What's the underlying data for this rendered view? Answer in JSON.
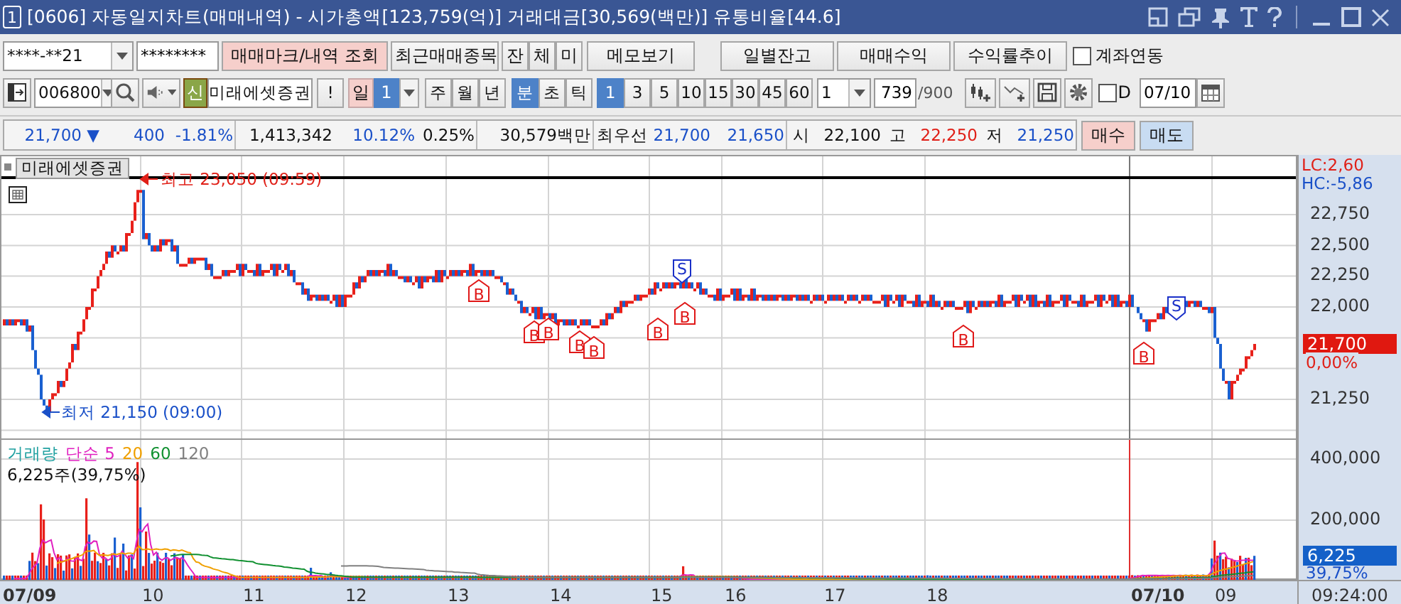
{
  "window": {
    "number": "1",
    "title": "[0606] 자동일지차트(매매내역) - 시가총액[123,759(억)] 거래대금[30,569(백만)] 유통비율[44.6]"
  },
  "toolbar_1": {
    "account": "****-**21",
    "password": "********",
    "buttons": [
      {
        "label": "매매마크/내역 조회",
        "kind": "primary"
      },
      {
        "label": "최근매매종목",
        "kind": "normal"
      },
      {
        "label": "잔",
        "kind": "small"
      },
      {
        "label": "체",
        "kind": "small"
      },
      {
        "label": "미",
        "kind": "small"
      },
      {
        "label": "메모보기",
        "kind": "wide"
      }
    ],
    "right_buttons": [
      "일별잔고",
      "매매수익",
      "수익률추이"
    ],
    "link_account": {
      "label": "계좌연동",
      "checked": false
    }
  },
  "toolbar_2": {
    "code": "006800",
    "credit_badge": "신",
    "stock_name": "미래에셋증권",
    "alert": "!",
    "day": {
      "label": "일",
      "value": "1"
    },
    "periods": [
      {
        "label": "주",
        "selected": false
      },
      {
        "label": "월",
        "selected": false
      },
      {
        "label": "년",
        "selected": false
      },
      {
        "label": "분",
        "selected": true
      },
      {
        "label": "초",
        "selected": false
      },
      {
        "label": "틱",
        "selected": false
      }
    ],
    "intervals": [
      {
        "label": "1",
        "selected": true
      },
      {
        "label": "3",
        "selected": false
      },
      {
        "label": "5",
        "selected": false
      },
      {
        "label": "10",
        "selected": false
      },
      {
        "label": "15",
        "selected": false
      },
      {
        "label": "30",
        "selected": false
      },
      {
        "label": "45",
        "selected": false
      },
      {
        "label": "60",
        "selected": false
      }
    ],
    "count_combo": "1",
    "count": "739",
    "max_count": "/900",
    "d_option": {
      "label": "D",
      "checked": false
    },
    "date": "07/10"
  },
  "quote_strip": {
    "items": [
      {
        "text": "21,700 ▼",
        "color": "#1a50c8"
      },
      {
        "text": "400",
        "color": "#1a50c8"
      },
      {
        "text": "-1.81%",
        "color": "#1a50c8"
      },
      {
        "text": "1,413,342",
        "color": "#111111"
      },
      {
        "text": "10.12%",
        "color": "#1a50c8"
      },
      {
        "text": "0.25%",
        "color": "#111111"
      },
      {
        "text": "30,579백만",
        "color": "#111111"
      },
      {
        "text": "최우선",
        "color": "#111111"
      },
      {
        "text": "21,700",
        "color": "#1a50c8"
      },
      {
        "text": "21,650",
        "color": "#1a50c8"
      },
      {
        "text": "시",
        "color": "#111111"
      },
      {
        "text": "22,100",
        "color": "#111111"
      },
      {
        "text": "고",
        "color": "#111111"
      },
      {
        "text": "22,250",
        "color": "#e02018"
      },
      {
        "text": "저",
        "color": "#111111"
      },
      {
        "text": "21,250",
        "color": "#1a50c8"
      }
    ],
    "buy": "매수",
    "sell": "매도"
  },
  "chart": {
    "stock_label": "미래에셋증권",
    "high_annotation": "최고 23,050 (09:59)",
    "low_annotation": "최저 21,150 (09:00)",
    "lc": "LC:2,60",
    "hc": "HC:-5,86",
    "price_ticks": [
      "22,750",
      "22,500",
      "22,250",
      "22,000",
      "21,250"
    ],
    "current_price": "21,700",
    "current_change": "0,00%",
    "markers": [
      {
        "label": "B",
        "kind": "buy"
      },
      {
        "label": "B",
        "kind": "buy"
      },
      {
        "label": "B",
        "kind": "buy"
      },
      {
        "label": "B",
        "kind": "buy"
      },
      {
        "label": "B",
        "kind": "buy"
      },
      {
        "label": "B",
        "kind": "buy"
      },
      {
        "label": "S",
        "kind": "sell"
      },
      {
        "label": "B",
        "kind": "buy"
      },
      {
        "label": "B",
        "kind": "buy"
      },
      {
        "label": "B",
        "kind": "buy"
      },
      {
        "label": "S",
        "kind": "sell"
      }
    ],
    "volume_legend": [
      {
        "text": "거래량",
        "color": "#20a0a0"
      },
      {
        "text": "단순 5",
        "color": "#e020c0"
      },
      {
        "text": "20",
        "color": "#f0a000"
      },
      {
        "text": "60",
        "color": "#109030"
      },
      {
        "text": "120",
        "color": "#808080"
      }
    ],
    "volume_info": "6,225주(39,75%)",
    "volume_ticks": [
      "400,000",
      "200,000"
    ],
    "current_volume": "6,225",
    "current_volume_ratio": "39,75%",
    "x_labels": [
      {
        "text": "07/09",
        "bold": true
      },
      {
        "text": "10",
        "bold": false
      },
      {
        "text": "11",
        "bold": false
      },
      {
        "text": "12",
        "bold": false
      },
      {
        "text": "13",
        "bold": false
      },
      {
        "text": "14",
        "bold": false
      },
      {
        "text": "15",
        "bold": false
      },
      {
        "text": "16",
        "bold": false
      },
      {
        "text": "17",
        "bold": false
      },
      {
        "text": "18",
        "bold": false
      },
      {
        "text": "07/10",
        "bold": true
      },
      {
        "text": "09",
        "bold": false
      }
    ],
    "cursor_time": "09:24:00"
  }
}
